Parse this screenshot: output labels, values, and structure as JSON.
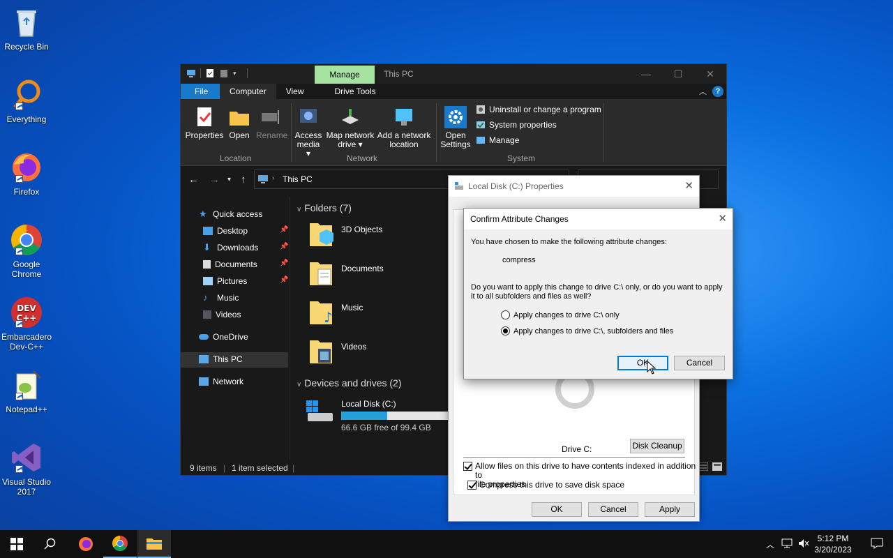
{
  "desktop": {
    "icons": [
      {
        "label": "Recycle Bin",
        "icon": "recycle-bin-icon"
      },
      {
        "label": "Everything",
        "icon": "everything-search-icon"
      },
      {
        "label": "Firefox",
        "icon": "firefox-icon"
      },
      {
        "label": "Google Chrome",
        "icon": "chrome-icon"
      },
      {
        "label": "Embarcadero Dev-C++",
        "icon": "devcpp-icon"
      },
      {
        "label": "Notepad++",
        "icon": "notepadpp-icon"
      },
      {
        "label": "Visual Studio 2017",
        "icon": "visual-studio-icon"
      }
    ]
  },
  "explorer": {
    "context_tab": "Manage",
    "title": "This PC",
    "ribbon_tabs": [
      "File",
      "Computer",
      "View",
      "Drive Tools"
    ],
    "ribbon": {
      "properties": "Properties",
      "open": "Open",
      "rename": "Rename",
      "access_media_1": "Access",
      "access_media_2": "media",
      "map_drive_1": "Map network",
      "map_drive_2": "drive",
      "add_location_1": "Add a network",
      "add_location_2": "location",
      "open_settings_1": "Open",
      "open_settings_2": "Settings",
      "uninstall": "Uninstall or change a program",
      "system_properties": "System properties",
      "manage": "Manage",
      "group_location": "Location",
      "group_network": "Network",
      "group_system": "System"
    },
    "address": "This PC",
    "nav": {
      "quick_access": "Quick access",
      "desktop": "Desktop",
      "downloads": "Downloads",
      "documents": "Documents",
      "pictures": "Pictures",
      "music": "Music",
      "videos": "Videos",
      "onedrive": "OneDrive",
      "this_pc": "This PC",
      "network": "Network"
    },
    "folders_header": "Folders (7)",
    "folders": [
      "3D Objects",
      "Documents",
      "Music",
      "Videos"
    ],
    "drives_header": "Devices and drives (2)",
    "drive": {
      "name": "Local Disk (C:)",
      "free": "66.6 GB free of 99.4 GB",
      "used_fraction": 0.33
    },
    "status": {
      "items": "9 items",
      "selected": "1 item selected"
    }
  },
  "properties_dialog": {
    "title": "Local Disk (C:) Properties",
    "drive_label": "Drive C:",
    "disk_cleanup": "Disk Cleanup",
    "compress_label": "Compress this drive to save disk space",
    "index_label_1": "Allow files on this drive to have contents indexed in addition to",
    "index_label_2": "file properties",
    "ok": "OK",
    "cancel": "Cancel",
    "apply": "Apply"
  },
  "confirm_dialog": {
    "title": "Confirm Attribute Changes",
    "intro": "You have chosen to make the following attribute changes:",
    "change": "compress",
    "question_1": "Do you want to apply this change to drive C:\\ only, or do you want to apply",
    "question_2": "it to all subfolders and files as well?",
    "option_1": "Apply changes to drive C:\\ only",
    "option_2": "Apply changes to drive C:\\, subfolders and files",
    "ok": "OK",
    "cancel": "Cancel"
  },
  "taskbar": {
    "time": "5:12 PM",
    "date": "3/20/2023"
  },
  "colors": {
    "accent": "#1979ca",
    "manage_tab": "#a6e3a1",
    "drive_fill": "#26a0da"
  }
}
